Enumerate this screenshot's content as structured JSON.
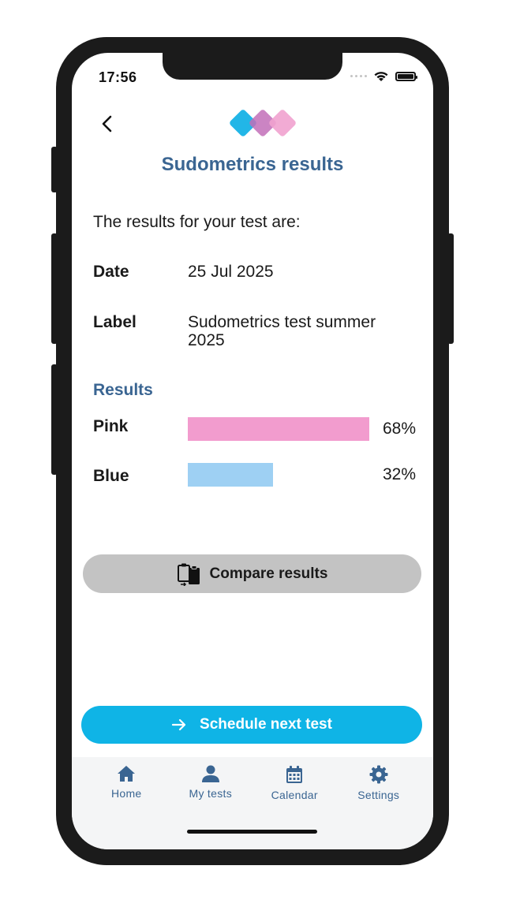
{
  "status_bar": {
    "time": "17:56"
  },
  "header": {
    "title": "Sudometrics results"
  },
  "content": {
    "intro": "The results for your test are:",
    "date_label": "Date",
    "date_value": "25 Jul 2025",
    "label_label": "Label",
    "label_value": "Sudometrics test summer 2025",
    "results_heading": "Results",
    "results": [
      {
        "name": "Pink",
        "percent_label": "68%",
        "fraction": 0.68,
        "color": "#f29cce"
      },
      {
        "name": "Blue",
        "percent_label": "32%",
        "fraction": 0.32,
        "color": "#9ed0f3"
      }
    ]
  },
  "actions": {
    "compare_label": "Compare results",
    "schedule_label": "Schedule next test"
  },
  "tabbar": {
    "items": [
      {
        "label": "Home",
        "icon": "home-icon"
      },
      {
        "label": "My tests",
        "icon": "person-icon"
      },
      {
        "label": "Calendar",
        "icon": "calendar-icon"
      },
      {
        "label": "Settings",
        "icon": "gear-icon"
      }
    ]
  },
  "colors": {
    "title": "#3a6592",
    "primary_button": "#0fb4e6",
    "secondary_button": "#c3c3c3",
    "logo_cyan": "#16b2e6",
    "logo_purple": "#c26eb8",
    "logo_pink": "#f1a2cf"
  }
}
